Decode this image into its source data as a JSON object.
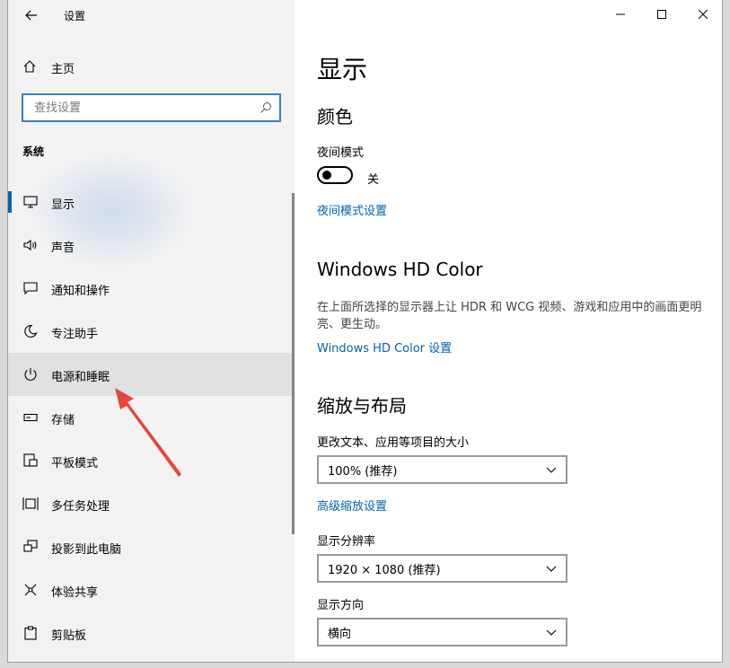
{
  "window": {
    "title": "设置"
  },
  "sidebar": {
    "home_label": "主页",
    "search_placeholder": "查找设置",
    "section_label": "系统",
    "items": [
      {
        "label": "显示",
        "icon": "monitor-icon"
      },
      {
        "label": "声音",
        "icon": "speaker-icon"
      },
      {
        "label": "通知和操作",
        "icon": "notification-icon"
      },
      {
        "label": "专注助手",
        "icon": "moon-icon"
      },
      {
        "label": "电源和睡眠",
        "icon": "power-icon"
      },
      {
        "label": "存储",
        "icon": "storage-icon"
      },
      {
        "label": "平板模式",
        "icon": "tablet-icon"
      },
      {
        "label": "多任务处理",
        "icon": "multitask-icon"
      },
      {
        "label": "投影到此电脑",
        "icon": "project-icon"
      },
      {
        "label": "体验共享",
        "icon": "share-icon"
      },
      {
        "label": "剪贴板",
        "icon": "clipboard-icon"
      }
    ]
  },
  "main": {
    "page_title": "显示",
    "color": {
      "heading": "颜色",
      "night_light_label": "夜间模式",
      "night_light_state": "关",
      "night_light_link": "夜间模式设置"
    },
    "hdr": {
      "heading": "Windows HD Color",
      "description": "在上面所选择的显示器上让 HDR 和 WCG 视频、游戏和应用中的画面更明亮、更生动。",
      "link": "Windows HD Color 设置"
    },
    "scale": {
      "heading": "缩放与布局",
      "scale_label": "更改文本、应用等项目的大小",
      "scale_value": "100% (推荐)",
      "advanced_link": "高级缩放设置",
      "resolution_label": "显示分辨率",
      "resolution_value": "1920 × 1080 (推荐)",
      "orientation_label": "显示方向",
      "orientation_value": "横向"
    }
  },
  "colors": {
    "accent": "#0063b1",
    "annotation_arrow": "#e8443a"
  }
}
